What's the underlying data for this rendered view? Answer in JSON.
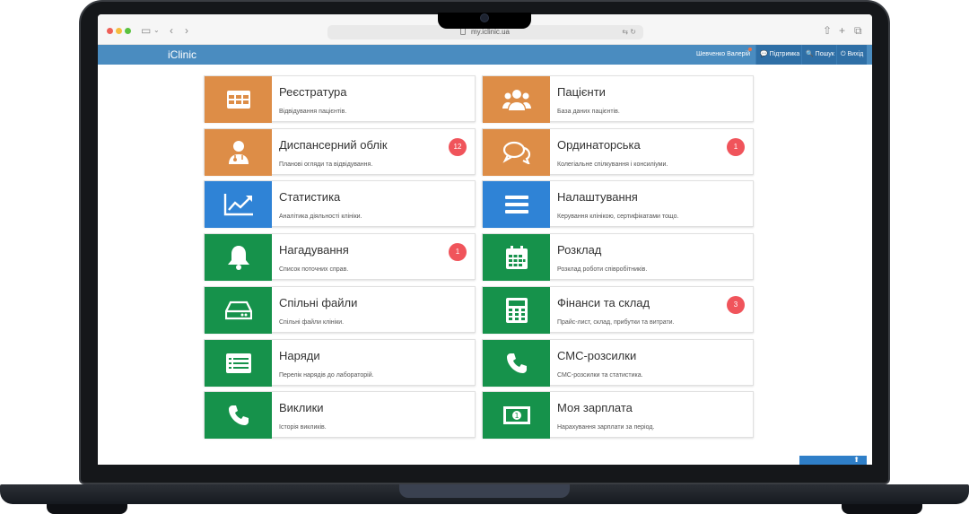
{
  "browser": {
    "url": "my.iclinic.ua"
  },
  "navbar": {
    "brand": "iClinic",
    "user": "Шевченко Валерій",
    "support_label": "Підтримка",
    "search_label": "Пошук",
    "logout_label": "Вихід"
  },
  "tiles": [
    {
      "title": "Реєстратура",
      "desc": "Відвідування пацієнтів.",
      "color": "#dd8d47",
      "icon": "grid-table-icon",
      "badge": ""
    },
    {
      "title": "Пацієнти",
      "desc": "База даних пацієнтів.",
      "color": "#dd8d47",
      "icon": "users-icon",
      "badge": ""
    },
    {
      "title": "Диспансерний облік",
      "desc": "Планові огляди та відвідування.",
      "color": "#dd8d47",
      "icon": "doctor-icon",
      "badge": "12"
    },
    {
      "title": "Ординаторська",
      "desc": "Колегіальне спілкування і консиліуми.",
      "color": "#dd8d47",
      "icon": "chat-icon",
      "badge": "1"
    },
    {
      "title": "Статистика",
      "desc": "Аналітика діяльності клініки.",
      "color": "#2f83d6",
      "icon": "line-chart-icon",
      "badge": ""
    },
    {
      "title": "Налаштування",
      "desc": "Керування клінікою, сертифікатами тощо.",
      "color": "#2f83d6",
      "icon": "menu-bars-icon",
      "badge": ""
    },
    {
      "title": "Нагадування",
      "desc": "Список поточних справ.",
      "color": "#16924b",
      "icon": "bell-icon",
      "badge": "1"
    },
    {
      "title": "Розклад",
      "desc": "Розклад роботи співробітників.",
      "color": "#16924b",
      "icon": "calendar-icon",
      "badge": ""
    },
    {
      "title": "Спільні файли",
      "desc": "Спільні файли клініки.",
      "color": "#16924b",
      "icon": "hard-drive-icon",
      "badge": ""
    },
    {
      "title": "Фінанси та склад",
      "desc": "Прайс-лист, склад, прибутки та витрати.",
      "color": "#16924b",
      "icon": "calculator-icon",
      "badge": "3"
    },
    {
      "title": "Наряди",
      "desc": "Перелік нарядів до лабораторій.",
      "color": "#16924b",
      "icon": "list-card-icon",
      "badge": ""
    },
    {
      "title": "СМС-розсилки",
      "desc": "СМС-розсилки та статистика.",
      "color": "#16924b",
      "icon": "phone-icon",
      "badge": ""
    },
    {
      "title": "Виклики",
      "desc": "Історія викликів.",
      "color": "#16924b",
      "icon": "phone-icon",
      "badge": ""
    },
    {
      "title": "Моя зарплата",
      "desc": "Нарахування зарплати за період.",
      "color": "#16924b",
      "icon": "money-icon",
      "badge": ""
    }
  ]
}
